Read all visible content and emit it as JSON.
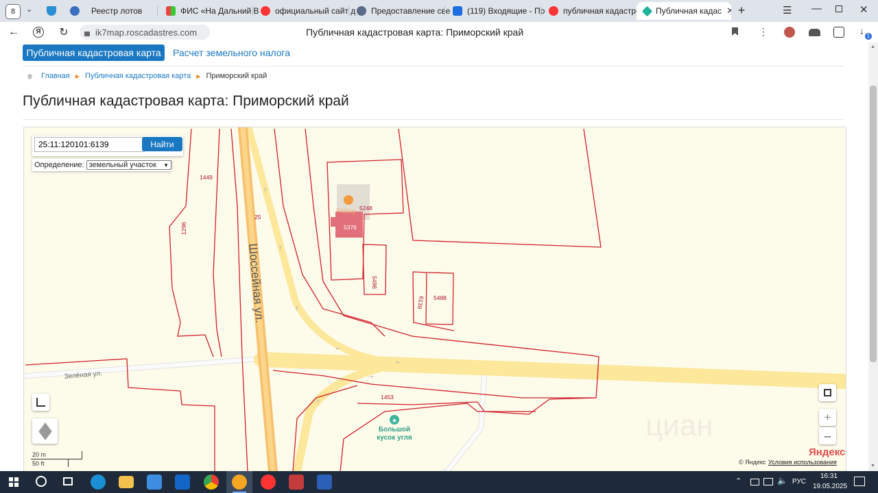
{
  "browser": {
    "tab_count": "8",
    "tabs": [
      {
        "title": "Реестр лотов"
      },
      {
        "title": "ФИС «На Дальний В"
      },
      {
        "title": "официальный сайт д"
      },
      {
        "title": "Предоставление све"
      },
      {
        "title": "(119) Входящие - По"
      },
      {
        "title": "публичная кадастро"
      },
      {
        "title": "Публичная кадас"
      }
    ],
    "url": "ik7map.roscadastres.com",
    "page_title": "Публичная кадастровая карта: Приморский край",
    "download_badge": "1"
  },
  "site": {
    "nav_active": "Публичная кадастровая карта",
    "nav_link": "Расчет земельного налога",
    "breadcrumb": {
      "home": "Главная",
      "map": "Публичная кадастровая карта",
      "current": "Приморский край"
    },
    "heading": "Публичная кадастровая карта: Приморский край"
  },
  "map": {
    "search_value": "25:11:120101:6139",
    "search_button": "Найти",
    "definition_label": "Определение:",
    "definition_value": "земельный участок",
    "definition_options": [
      "земельный участок"
    ],
    "parcel_labels": {
      "p1449": "1449",
      "p1296": "1296",
      "p25": "25",
      "p5248": "5248",
      "p5376": "5376",
      "p5498": "5498",
      "p6139": "6139",
      "p5488": "5488",
      "p1453": "1453"
    },
    "street_main": "Шоссейная ул.",
    "street_green": "Зелёная ул.",
    "poi_name": "Большой кусок угля",
    "poi_faded": "PitStop",
    "scale_m": "20 m",
    "scale_ft": "50 ft",
    "copyright": "© Яндекс",
    "terms": "Условия использования",
    "yandex_logo": "Яндекс",
    "watermark": "циан",
    "zoom_in": "+",
    "zoom_out": "–",
    "colors": {
      "parcel_border": "#d0202a",
      "road": "#fce79a",
      "road_major": "#f7c06d",
      "selected_parcel": "#e2707a"
    }
  },
  "taskbar": {
    "lang": "РУС",
    "time": "16:31",
    "date": "19.05.2025"
  }
}
